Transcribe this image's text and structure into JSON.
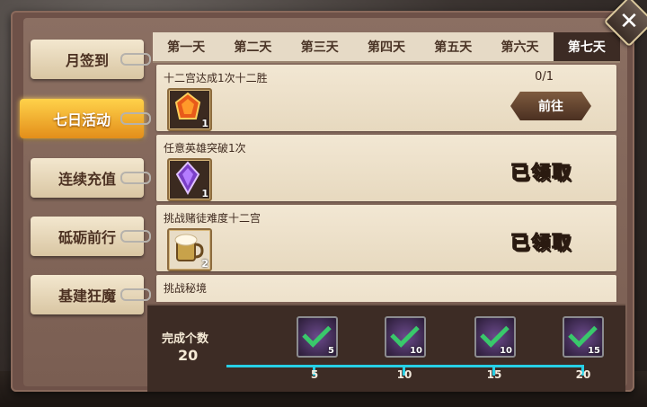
{
  "sidebar": {
    "items": [
      {
        "label": "月签到",
        "active": false
      },
      {
        "label": "七日活动",
        "active": true
      },
      {
        "label": "连续充值",
        "active": false
      },
      {
        "label": "砥砺前行",
        "active": false
      },
      {
        "label": "基建狂魔",
        "active": false
      }
    ]
  },
  "tabs": [
    {
      "label": "第一天",
      "active": false
    },
    {
      "label": "第二天",
      "active": false
    },
    {
      "label": "第三天",
      "active": false
    },
    {
      "label": "第四天",
      "active": false
    },
    {
      "label": "第五天",
      "active": false
    },
    {
      "label": "第六天",
      "active": false
    },
    {
      "label": "第七天",
      "active": true
    }
  ],
  "tasks": [
    {
      "title": "十二宫达成1次十二胜",
      "progress": "0/1",
      "button": "前往",
      "reward_icon": "orange-gem-icon",
      "reward_count": "1"
    },
    {
      "title": "任意英雄突破1次",
      "status": "已领取",
      "reward_icon": "purple-crystal-icon",
      "reward_count": "1"
    },
    {
      "title": "挑战赌徒难度十二宫",
      "status": "已领取",
      "reward_icon": "beer-mug-icon",
      "reward_count": "2"
    },
    {
      "title": "挑战秘境"
    }
  ],
  "completion": {
    "label": "完成个数",
    "count": "20",
    "milestones": [
      {
        "value": "5",
        "chest_count": "5",
        "claimed": true
      },
      {
        "value": "10",
        "chest_count": "10",
        "claimed": true
      },
      {
        "value": "15",
        "chest_count": "10",
        "claimed": true
      },
      {
        "value": "20",
        "chest_count": "15",
        "claimed": true
      }
    ]
  },
  "close_label": "✕",
  "colors": {
    "accent": "#e38e1a",
    "progress": "#27d0e6",
    "check": "#39c86b"
  }
}
